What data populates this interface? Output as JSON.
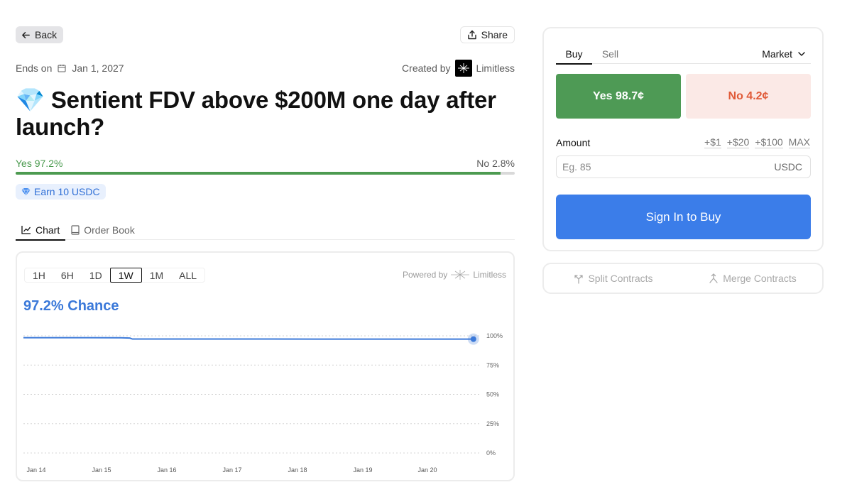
{
  "nav": {
    "back_label": "Back",
    "share_label": "Share"
  },
  "market": {
    "ends_label": "Ends on",
    "end_date": "Jan 1, 2027",
    "created_by_label": "Created by",
    "creator": "Limitless",
    "title_emoji": "💎",
    "title": "Sentient FDV above $200M one day after launch?",
    "yes_label": "Yes 97.2%",
    "no_label": "No 2.8%",
    "yes_fraction": 0.972,
    "earn_label": "Earn 10 USDC"
  },
  "content_tabs": [
    {
      "label": "Chart",
      "icon": "chart-line-icon"
    },
    {
      "label": "Order Book",
      "icon": "book-icon"
    }
  ],
  "chart_panel": {
    "ranges": [
      "1H",
      "6H",
      "1D",
      "1W",
      "1M",
      "ALL"
    ],
    "active_range": "1W",
    "powered_by_label": "Powered by",
    "powered_by_brand": "Limitless",
    "chance_label": "97.2% Chance"
  },
  "chart_data": {
    "type": "line",
    "title": "",
    "xlabel": "",
    "ylabel": "",
    "x_ticks": [
      "Jan 14",
      "Jan 15",
      "Jan 16",
      "Jan 17",
      "Jan 18",
      "Jan 19",
      "Jan 20"
    ],
    "y_ticks": [
      "0%",
      "25%",
      "50%",
      "75%",
      "100%"
    ],
    "ylim": [
      0,
      100
    ],
    "xlim": [
      0,
      7
    ],
    "grid": true,
    "series": [
      {
        "color": "#3b79d9",
        "x": [
          0,
          0.5,
          1.0,
          1.5,
          1.63,
          1.67,
          2.5,
          3.5,
          4.5,
          5.5,
          6.3,
          6.9
        ],
        "y": [
          98.4,
          98.4,
          98.4,
          98.3,
          98.1,
          97.3,
          97.3,
          97.3,
          97.2,
          97.2,
          97.2,
          97.2
        ]
      }
    ]
  },
  "trade": {
    "tabs": [
      "Buy",
      "Sell"
    ],
    "active_tab": "Buy",
    "order_type": "Market",
    "yes_button": "Yes 98.7¢",
    "no_button": "No 4.2¢",
    "amount_label": "Amount",
    "quick_amounts": [
      "+$1",
      "+$20",
      "+$100",
      "MAX"
    ],
    "amount_placeholder": "Eg. 85",
    "amount_unit": "USDC",
    "submit_label": "Sign In to Buy"
  },
  "contracts": {
    "split_label": "Split Contracts",
    "merge_label": "Merge Contracts"
  },
  "colors": {
    "yes": "#4e9a55",
    "no": "#e05a38",
    "accent": "#3b7de9",
    "chart_line": "#3b79d9"
  }
}
